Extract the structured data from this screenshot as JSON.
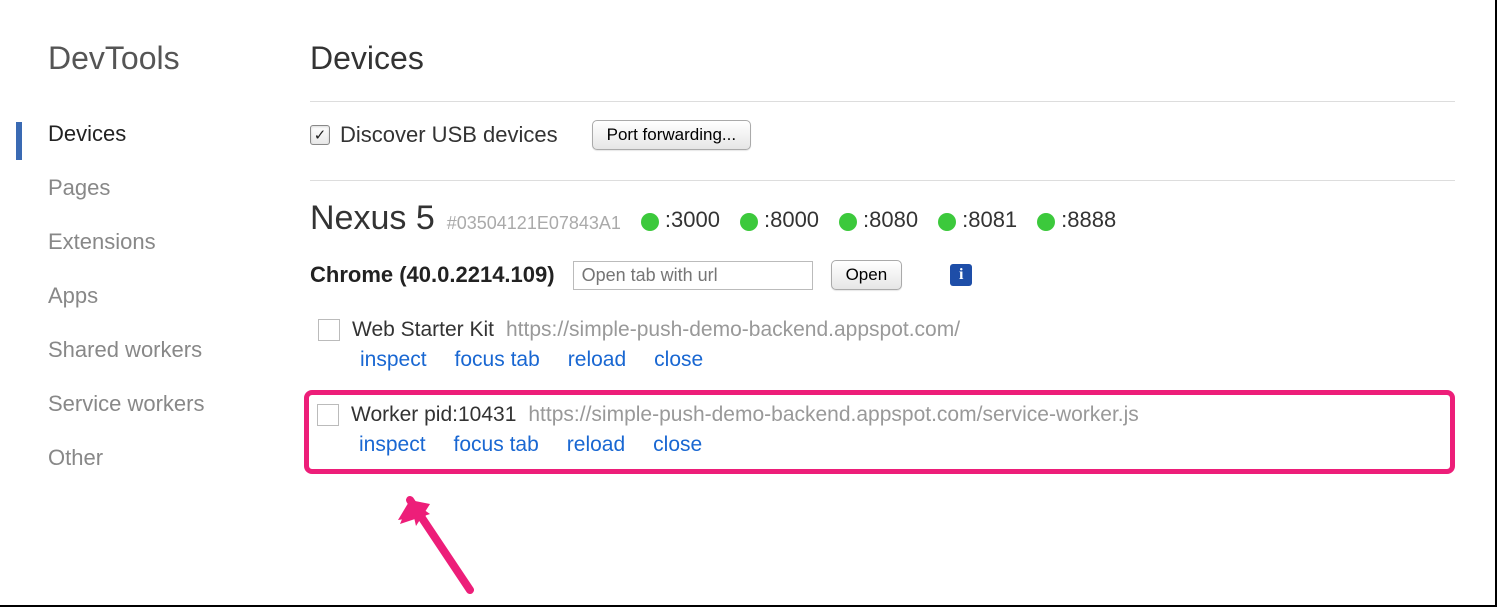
{
  "brand": "DevTools",
  "sidebar": {
    "items": [
      {
        "label": "Devices",
        "active": true
      },
      {
        "label": "Pages"
      },
      {
        "label": "Extensions"
      },
      {
        "label": "Apps"
      },
      {
        "label": "Shared workers"
      },
      {
        "label": "Service workers"
      },
      {
        "label": "Other"
      }
    ]
  },
  "page": {
    "title": "Devices",
    "discover_label": "Discover USB devices",
    "discover_checked": true,
    "port_forwarding_label": "Port forwarding..."
  },
  "device": {
    "name": "Nexus 5",
    "id": "#03504121E07843A1",
    "ports": [
      ":3000",
      ":8000",
      ":8080",
      ":8081",
      ":8888"
    ]
  },
  "browser": {
    "label": "Chrome (40.0.2214.109)",
    "url_placeholder": "Open tab with url",
    "open_label": "Open"
  },
  "targets": [
    {
      "title": "Web Starter Kit",
      "url": "https://simple-push-demo-backend.appspot.com/",
      "actions": {
        "inspect": "inspect",
        "focus": "focus tab",
        "reload": "reload",
        "close": "close"
      },
      "highlight": false
    },
    {
      "title": "Worker pid:10431",
      "url": "https://simple-push-demo-backend.appspot.com/service-worker.js",
      "actions": {
        "inspect": "inspect",
        "focus": "focus tab",
        "reload": "reload",
        "close": "close"
      },
      "highlight": true
    }
  ],
  "annotation": {
    "color": "#ed1e79"
  }
}
